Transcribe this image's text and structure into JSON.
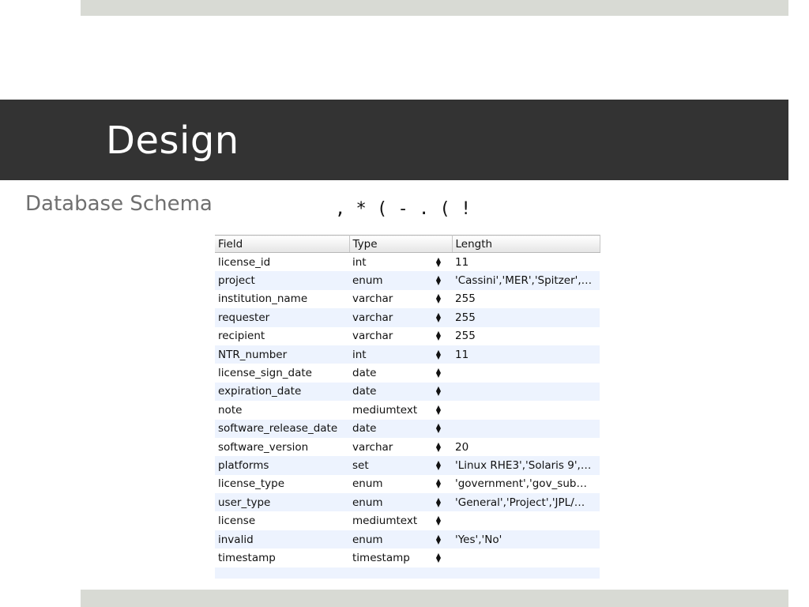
{
  "slide": {
    "title": "Design",
    "subtitle": "Database Schema",
    "garbled_text": ", * ( - . ( !"
  },
  "table": {
    "headers": [
      "Field",
      "Type",
      "Length"
    ],
    "rows": [
      {
        "field": "license_id",
        "type": "int",
        "length": "11"
      },
      {
        "field": "project",
        "type": "enum",
        "length": "'Cassini','MER','Spitzer',…"
      },
      {
        "field": "institution_name",
        "type": "varchar",
        "length": "255"
      },
      {
        "field": "requester",
        "type": "varchar",
        "length": "255"
      },
      {
        "field": "recipient",
        "type": "varchar",
        "length": "255"
      },
      {
        "field": "NTR_number",
        "type": "int",
        "length": "11"
      },
      {
        "field": "license_sign_date",
        "type": "date",
        "length": ""
      },
      {
        "field": "expiration_date",
        "type": "date",
        "length": ""
      },
      {
        "field": "note",
        "type": "mediumtext",
        "length": ""
      },
      {
        "field": "software_release_date",
        "type": "date",
        "length": ""
      },
      {
        "field": "software_version",
        "type": "varchar",
        "length": "20"
      },
      {
        "field": "platforms",
        "type": "set",
        "length": "'Linux RHE3','Solaris 9',…"
      },
      {
        "field": "license_type",
        "type": "enum",
        "length": "'government','gov_sub…"
      },
      {
        "field": "user_type",
        "type": "enum",
        "length": "'General','Project','JPL/…"
      },
      {
        "field": "license",
        "type": "mediumtext",
        "length": ""
      },
      {
        "field": "invalid",
        "type": "enum",
        "length": "'Yes','No'"
      },
      {
        "field": "timestamp",
        "type": "timestamp",
        "length": ""
      }
    ]
  },
  "colors": {
    "title_bar": "#333333",
    "band": "#d8dad4",
    "row_stripe": "#edf3fe",
    "subtitle": "#6f6f6f"
  },
  "icons": {
    "type_stepper": "up-down-arrows-icon"
  }
}
